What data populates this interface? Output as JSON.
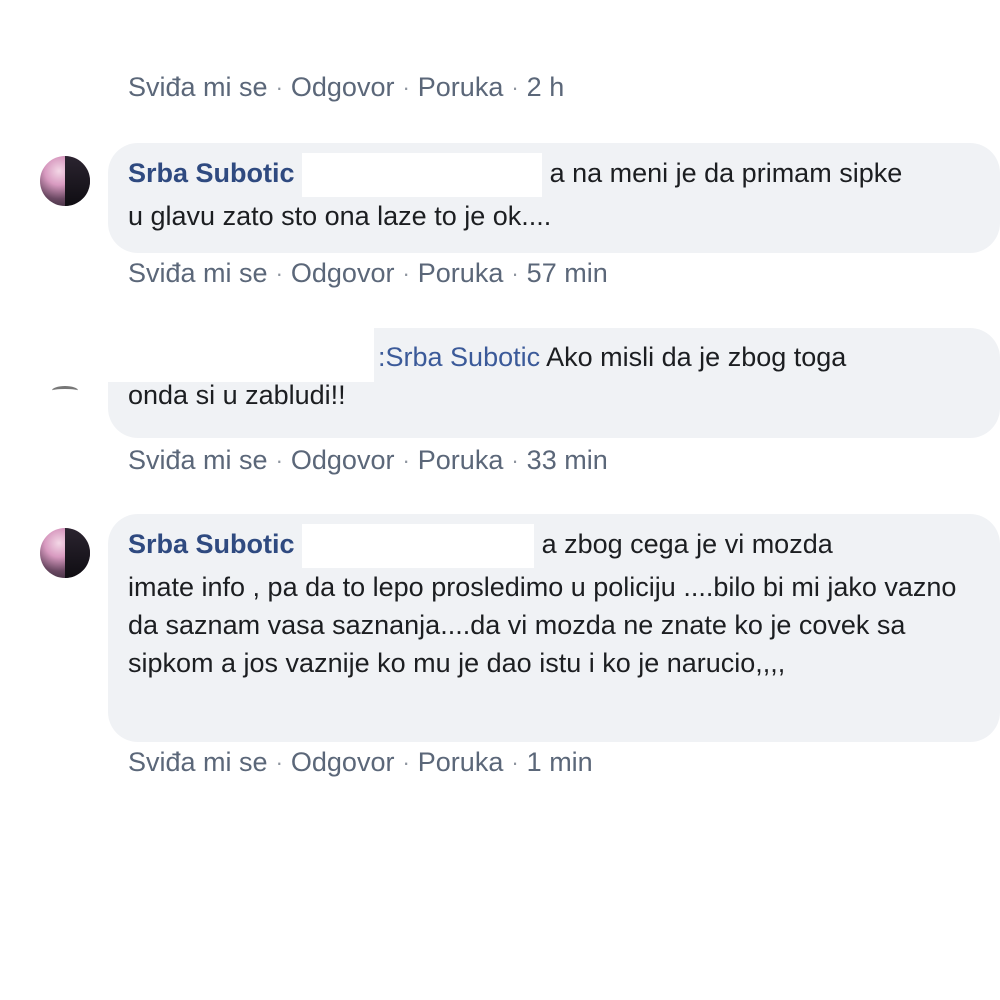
{
  "actions": {
    "like": "Sviđa mi se",
    "reply": "Odgovor",
    "message": "Poruka",
    "separator": "·"
  },
  "top_action_row": {
    "time": "2 h"
  },
  "comments": [
    {
      "author": "Srba Subotic",
      "text_line1": "a na meni je da primam sipke",
      "text_rest": "u glavu zato sto ona laze to je ok....",
      "time": "57 min"
    },
    {
      "mention": "Srba Subotic",
      "mention_prefix": ":",
      "text_line1": "Ako misli da je zbog toga",
      "text_rest": "onda si u zabludi!!",
      "time": "33 min"
    },
    {
      "author": "Srba Subotic",
      "text_line1": "a zbog cega je vi mozda",
      "text_rest": "imate info , pa da to lepo prosledimo u policiju ....bilo bi mi jako vazno da saznam vasa saznanja....da vi mozda ne znate ko je covek sa sipkom a jos vaznije ko mu je dao istu i ko je narucio,,,,",
      "time": "1 min"
    }
  ]
}
